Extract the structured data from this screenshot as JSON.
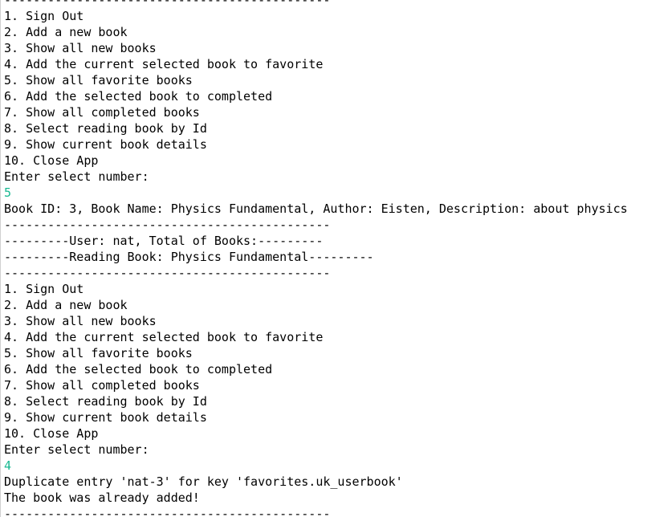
{
  "console": {
    "input_color": "#17b890",
    "lines": [
      {
        "text": "---------------------------------------------",
        "kind": "output"
      },
      {
        "text": "1. Sign Out",
        "kind": "output"
      },
      {
        "text": "2. Add a new book",
        "kind": "output"
      },
      {
        "text": "3. Show all new books",
        "kind": "output"
      },
      {
        "text": "4. Add the current selected book to favorite",
        "kind": "output"
      },
      {
        "text": "5. Show all favorite books",
        "kind": "output"
      },
      {
        "text": "6. Add the selected book to completed",
        "kind": "output"
      },
      {
        "text": "7. Show all completed books",
        "kind": "output"
      },
      {
        "text": "8. Select reading book by Id",
        "kind": "output"
      },
      {
        "text": "9. Show current book details",
        "kind": "output"
      },
      {
        "text": "10. Close App",
        "kind": "output"
      },
      {
        "text": "Enter select number:",
        "kind": "output"
      },
      {
        "text": "5",
        "kind": "input"
      },
      {
        "text": "Book ID: 3, Book Name: Physics Fundamental, Author: Eisten, Description: about physics",
        "kind": "output"
      },
      {
        "text": "---------------------------------------------",
        "kind": "output"
      },
      {
        "text": "---------User: nat, Total of Books:---------",
        "kind": "output"
      },
      {
        "text": "---------Reading Book: Physics Fundamental---------",
        "kind": "output"
      },
      {
        "text": "---------------------------------------------",
        "kind": "output"
      },
      {
        "text": "1. Sign Out",
        "kind": "output"
      },
      {
        "text": "2. Add a new book",
        "kind": "output"
      },
      {
        "text": "3. Show all new books",
        "kind": "output"
      },
      {
        "text": "4. Add the current selected book to favorite",
        "kind": "output"
      },
      {
        "text": "5. Show all favorite books",
        "kind": "output"
      },
      {
        "text": "6. Add the selected book to completed",
        "kind": "output"
      },
      {
        "text": "7. Show all completed books",
        "kind": "output"
      },
      {
        "text": "8. Select reading book by Id",
        "kind": "output"
      },
      {
        "text": "9. Show current book details",
        "kind": "output"
      },
      {
        "text": "10. Close App",
        "kind": "output"
      },
      {
        "text": "Enter select number:",
        "kind": "output"
      },
      {
        "text": "4",
        "kind": "input"
      },
      {
        "text": "Duplicate entry 'nat-3' for key 'favorites.uk_userbook'",
        "kind": "output"
      },
      {
        "text": "The book was already added!",
        "kind": "output"
      },
      {
        "text": "---------------------------------------------",
        "kind": "output"
      }
    ]
  }
}
